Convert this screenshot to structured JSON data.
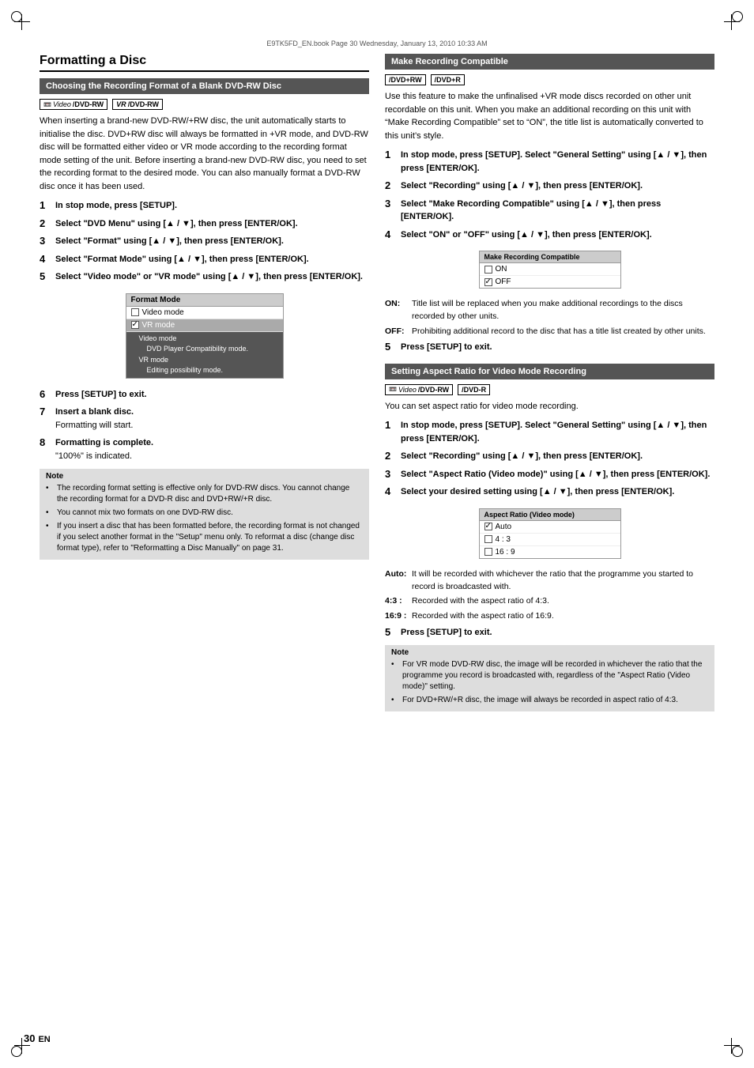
{
  "meta": {
    "file_info": "E9TK5FD_EN.book   Page 30   Wednesday, January 13, 2010   10:33 AM"
  },
  "left": {
    "section_title": "Formatting a Disc",
    "subsection_title": "Choosing the Recording Format of a Blank DVD-RW Disc",
    "disc_icons": [
      {
        "label": "Video DVD-RW"
      },
      {
        "label": "VR DVD-RW"
      }
    ],
    "body_text": "When inserting a brand-new DVD-RW/+RW disc, the unit automatically starts to initialise the disc. DVD+RW disc will always be formatted in +VR mode, and DVD-RW disc will be formatted either video or VR mode according to the recording format mode setting of the unit. Before inserting a brand-new DVD-RW disc, you need to set the recording format to the desired mode. You can also manually format a DVD-RW disc once it has been used.",
    "steps": [
      {
        "num": "1",
        "text": "In stop mode, press [SETUP]."
      },
      {
        "num": "2",
        "text": "Select “DVD Menu” using [▲ / ▼], then press [ENTER/OK]."
      },
      {
        "num": "3",
        "text": "Select “Format” using [▲ / ▼], then press [ENTER/OK]."
      },
      {
        "num": "4",
        "text": "Select “Format Mode” using [▲ / ▼], then press [ENTER/OK]."
      },
      {
        "num": "5",
        "text": "Select “Video mode” or “VR mode” using [▲ / ▼], then press [ENTER/OK]."
      }
    ],
    "format_mode_box": {
      "header": "Format Mode",
      "items": [
        {
          "label": "Video mode",
          "checked": false
        },
        {
          "label": "VR mode",
          "checked": true
        }
      ],
      "desc_lines": [
        "Video mode",
        "     DVD Player Compatibility mode.",
        "VR mode",
        "     Editing possibility mode."
      ]
    },
    "steps_cont": [
      {
        "num": "6",
        "text": "Press [SETUP] to exit."
      },
      {
        "num": "7",
        "text": "Insert a blank disc.",
        "sub": "Formatting will start."
      },
      {
        "num": "8",
        "text": "Formatting is complete.",
        "sub": "“100%” is indicated."
      }
    ],
    "note": {
      "title": "Note",
      "items": [
        "The recording format setting is effective only for DVD-RW discs. You cannot change the recording format for a DVD-R disc and DVD+RW/+R disc.",
        "You cannot mix two formats on one DVD-RW disc.",
        "If you insert a disc that has been formatted before, the recording format is not changed if you select another format in the “Setup” menu only. To reformat a disc (change disc format type), refer to “Reformatting a Disc Manually” on page 31."
      ]
    }
  },
  "right": {
    "make_compatible": {
      "section_title": "Make Recording Compatible",
      "disc_icons": [
        {
          "label": "DVD+RW"
        },
        {
          "label": "DVD+R"
        }
      ],
      "body_text": "Use this feature to make the unfinalised +VR mode discs recorded on other unit recordable on this unit. When you make an additional recording on this unit with “Make Recording Compatible” set to “ON”, the title list is automatically converted to this unit’s style.",
      "steps": [
        {
          "num": "1",
          "text": "In stop mode, press [SETUP]. Select “General Setting” using [▲ / ▼], then press [ENTER/OK]."
        },
        {
          "num": "2",
          "text": "Select “Recording” using [▲ / ▼], then press [ENTER/OK]."
        },
        {
          "num": "3",
          "text": "Select “Make Recording Compatible” using [▲ / ▼], then press [ENTER/OK]."
        },
        {
          "num": "4",
          "text": "Select “ON” or “OFF” using [▲ / ▼], then press [ENTER/OK]."
        }
      ],
      "compat_box": {
        "header": "Make Recording Compatible",
        "items": [
          {
            "label": "ON",
            "checked": false
          },
          {
            "label": "OFF",
            "checked": true
          }
        ]
      },
      "on_off": [
        {
          "key": "ON:",
          "desc": "Title list will be replaced when you make additional recordings to the discs recorded by other units."
        },
        {
          "key": "OFF:",
          "desc": "Prohibiting additional record to the disc that has a title list created by other units."
        }
      ],
      "step5": "Press [SETUP] to exit."
    },
    "aspect_ratio": {
      "section_title": "Setting Aspect Ratio for Video Mode Recording",
      "disc_icons": [
        {
          "label": "Video DVD-RW"
        },
        {
          "label": "DVD-R"
        }
      ],
      "body_text": "You can set aspect ratio for video mode recording.",
      "steps": [
        {
          "num": "1",
          "text": "In stop mode, press [SETUP]. Select “General Setting” using [▲ / ▼], then press [ENTER/OK]."
        },
        {
          "num": "2",
          "text": "Select “Recording” using [▲ / ▼], then press [ENTER/OK]."
        },
        {
          "num": "3",
          "text": "Select “Aspect Ratio (Video mode)” using [▲ / ▼], then press [ENTER/OK]."
        },
        {
          "num": "4",
          "text": "Select your desired setting using [▲ / ▼], then press [ENTER/OK]."
        }
      ],
      "aspect_box": {
        "header": "Aspect Ratio (Video mode)",
        "items": [
          {
            "label": "Auto",
            "checked": true
          },
          {
            "label": "4 : 3",
            "checked": false
          },
          {
            "label": "16 : 9",
            "checked": false
          }
        ]
      },
      "ratios": [
        {
          "key": "Auto:",
          "desc": "It will be recorded with whichever the ratio that the programme you started to record is broadcasted with."
        },
        {
          "key": "4:3 :",
          "desc": "Recorded with the aspect ratio of 4:3."
        },
        {
          "key": "16:9 :",
          "desc": "Recorded with the aspect ratio of 16:9."
        }
      ],
      "step5": "Press [SETUP] to exit.",
      "note": {
        "title": "Note",
        "items": [
          "For VR mode DVD-RW disc, the image will be recorded in whichever the ratio that the programme you record is broadcasted with, regardless of the “Aspect Ratio (Video mode)” setting.",
          "For DVD+RW/+R disc, the image will always be recorded in aspect ratio of 4:3."
        ]
      }
    }
  },
  "footer": {
    "page_num": "30",
    "lang": "EN"
  }
}
